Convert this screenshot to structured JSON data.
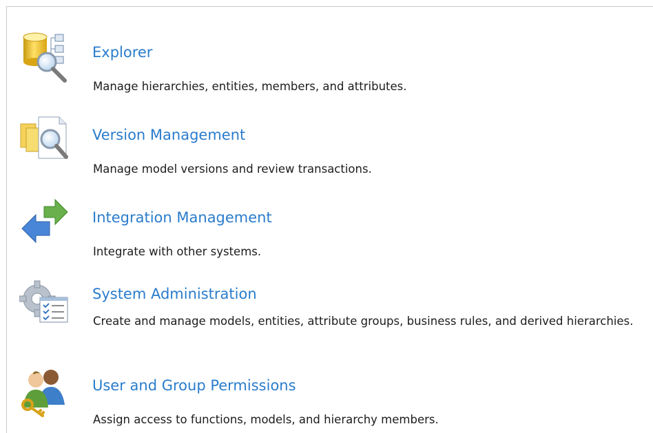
{
  "items": [
    {
      "title": "Explorer",
      "description": "Manage hierarchies, entities, members, and attributes.",
      "icon": "explorer-icon"
    },
    {
      "title": "Version Management",
      "description": "Manage model versions and review transactions.",
      "icon": "version-management-icon"
    },
    {
      "title": "Integration Management",
      "description": "Integrate with other systems.",
      "icon": "integration-arrows-icon"
    },
    {
      "title": "System Administration",
      "description": "Create and manage models, entities, attribute groups, business rules, and derived hierarchies.",
      "icon": "system-administration-icon"
    },
    {
      "title": "User and Group Permissions",
      "description": "Assign access to functions, models, and hierarchy members.",
      "icon": "user-group-permissions-icon"
    }
  ],
  "colors": {
    "link": "#2a7ccc",
    "text": "#1c1c1c",
    "border": "#c8c8c8"
  }
}
